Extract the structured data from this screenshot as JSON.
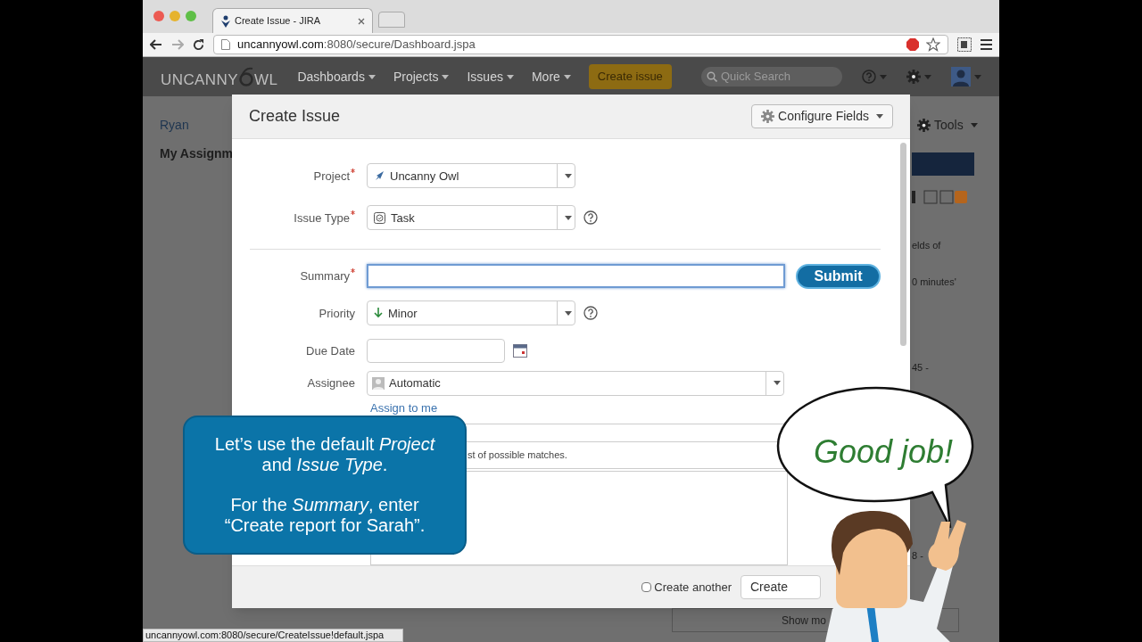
{
  "browser": {
    "tab_title": "Create Issue - JIRA",
    "address_host": "uncannyowl.com",
    "address_path": ":8080/secure/Dashboard.jspa",
    "status_url": "uncannyowl.com:8080/secure/CreateIssue!default.jspa"
  },
  "nav": {
    "logo": [
      "UNCANNY",
      "WL"
    ],
    "menus": [
      "Dashboards",
      "Projects",
      "Issues",
      "More"
    ],
    "create_button": "Create issue",
    "search_placeholder": "Quick Search"
  },
  "background": {
    "user": "Ryan",
    "section": "My Assignm",
    "tools": "Tools",
    "fragments": [
      "elds of",
      "0 minutes'",
      "45 -",
      "8 -"
    ],
    "show_more": "Show mo"
  },
  "dialog": {
    "title": "Create Issue",
    "configure_button": "Configure Fields",
    "fields": [
      {
        "kind": "project",
        "label": "Project",
        "required": true,
        "value": "Uncanny Owl",
        "help": false
      },
      {
        "kind": "issue_type",
        "label": "Issue Type",
        "required": true,
        "value": "Task",
        "help": true
      },
      {
        "kind": "divider"
      },
      {
        "kind": "text",
        "label": "Summary",
        "required": true,
        "focused": true,
        "action": "Submit"
      },
      {
        "kind": "priority",
        "label": "Priority",
        "required": false,
        "value": "Minor",
        "help": true
      },
      {
        "kind": "date",
        "label": "Due Date",
        "required": false
      },
      {
        "kind": "user",
        "label": "Assignee",
        "required": false,
        "value": "Automatic",
        "link": "Assign to me"
      },
      {
        "kind": "blank"
      },
      {
        "kind": "hint",
        "text": "st of possible matches."
      },
      {
        "kind": "textarea"
      }
    ],
    "create_another": {
      "label": "Create another",
      "checked": false
    },
    "create_button": "Create"
  },
  "callout": {
    "paragraphs": [
      "Let’s use the default *Project* and *Issue Type*.",
      "For the *Summary*, enter “Create report for Sarah”."
    ]
  },
  "bubble": {
    "text": "Good job!"
  }
}
